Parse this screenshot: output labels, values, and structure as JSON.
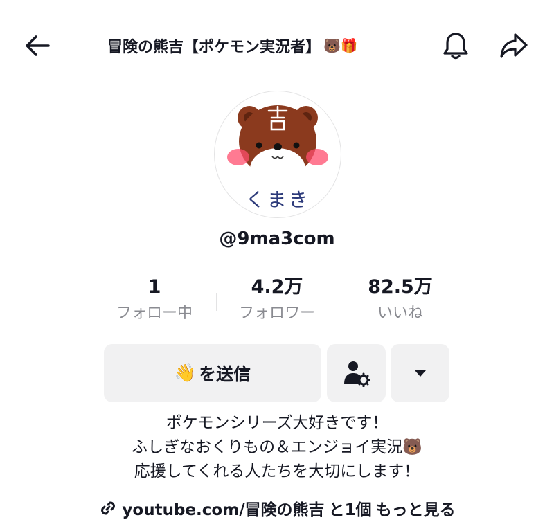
{
  "header": {
    "title": "冒険の熊吉【ポケモン実況者】",
    "title_emojis": "🐻🎁"
  },
  "profile": {
    "avatar_text": "くまき",
    "handle": "@9ma3com"
  },
  "stats": [
    {
      "value": "1",
      "label": "フォロー中"
    },
    {
      "value": "4.2万",
      "label": "フォロワー"
    },
    {
      "value": "82.5万",
      "label": "いいね"
    }
  ],
  "actions": {
    "send_emoji": "👋",
    "send_label": "を送信"
  },
  "bio": {
    "line1": "ポケモンシリーズ大好きです！",
    "line2": "ふしぎなおくりもの＆エンジョイ実況",
    "line2_emoji": "🐻",
    "line3": "応援してくれる人たちを大切にします！"
  },
  "link": {
    "url_text": "youtube.com/冒険の熊吉",
    "suffix": "と1個",
    "more": "もっと見る"
  },
  "colors": {
    "text": "#161823",
    "secondary": "#8a8b91",
    "button_bg": "#f1f1f2",
    "bear_brown": "#8b3a1e"
  }
}
